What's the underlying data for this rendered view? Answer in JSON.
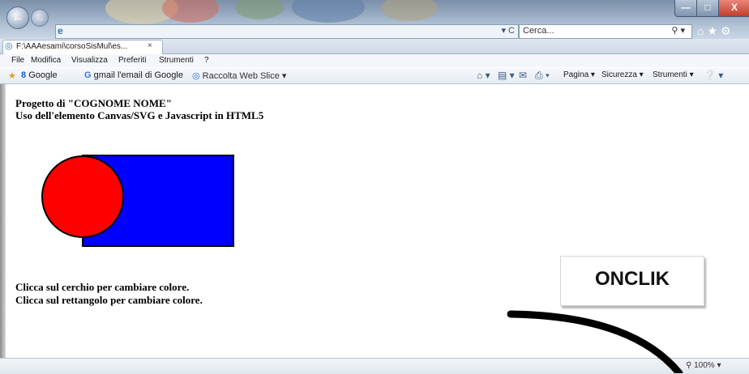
{
  "browser": {
    "address_url": "",
    "search_placeholder": "Cerca...",
    "tab_label": "F:\\AAAesami\\corsoSisMul\\es...",
    "tab_close": "×",
    "menu": [
      "File",
      "Modifica",
      "Visualizza",
      "Preferiti",
      "Strumenti",
      "?"
    ],
    "favorites": [
      {
        "icon": "star-icon",
        "label": ""
      },
      {
        "icon": "google-icon",
        "label": "Google"
      },
      {
        "icon": "google-g-icon",
        "label": "gmail l'email di Google"
      },
      {
        "icon": "ie-page-icon",
        "label": "Raccolta Web Slice ▾"
      }
    ],
    "commands": {
      "pagina": "Pagina ▾",
      "sicurezza": "Sicurezza ▾",
      "strumenti": "Strumenti ▾"
    },
    "zoom": "100%"
  },
  "page": {
    "heading_1": "Progetto di \"COGNOME NOME\"",
    "heading_2": "Uso dell'elemento Canvas/SVG e Javascript in HTML5",
    "instruction_circle": "Clicca sul cerchio per cambiare colore.",
    "instruction_rect": "Clicca sul rettangolo per cambiare colore.",
    "shapes": {
      "rectangle_color": "#0000ff",
      "circle_color": "#ff0000"
    }
  },
  "annotation": {
    "label": "ONCLIK",
    "arrow_color": "#000000"
  },
  "colors": {
    "titlebar": "#96a9c0",
    "close_button": "#c33d2c"
  }
}
